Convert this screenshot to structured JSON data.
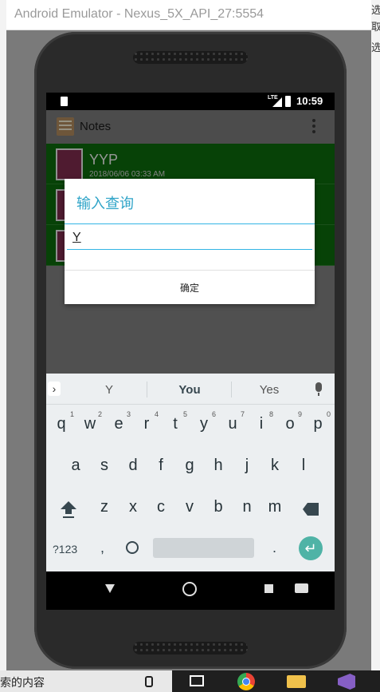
{
  "window": {
    "title": "Android Emulator - Nexus_5X_API_27:5554"
  },
  "statusbar": {
    "network": "LTE",
    "time": "10:59"
  },
  "app": {
    "title": "Notes"
  },
  "notes": [
    {
      "title": "YYP",
      "date": "2018/06/06 03:33 AM"
    }
  ],
  "dialog": {
    "title": "输入查询",
    "input_value": "Y",
    "confirm_label": "确定"
  },
  "suggestions": [
    "Y",
    "You",
    "Yes"
  ],
  "keyboard": {
    "row1": [
      "q",
      "w",
      "e",
      "r",
      "t",
      "y",
      "u",
      "i",
      "o",
      "p"
    ],
    "row1_hints": [
      "1",
      "2",
      "3",
      "4",
      "5",
      "6",
      "7",
      "8",
      "9",
      "0"
    ],
    "row2": [
      "a",
      "s",
      "d",
      "f",
      "g",
      "h",
      "j",
      "k",
      "l"
    ],
    "row3": [
      "z",
      "x",
      "c",
      "v",
      "b",
      "n",
      "m"
    ],
    "symbols_label": "?123",
    "comma": ",",
    "period": "."
  },
  "background": {
    "taskbar_text": "索的内容",
    "right_fragments": [
      "选",
      "取",
      "选"
    ]
  }
}
